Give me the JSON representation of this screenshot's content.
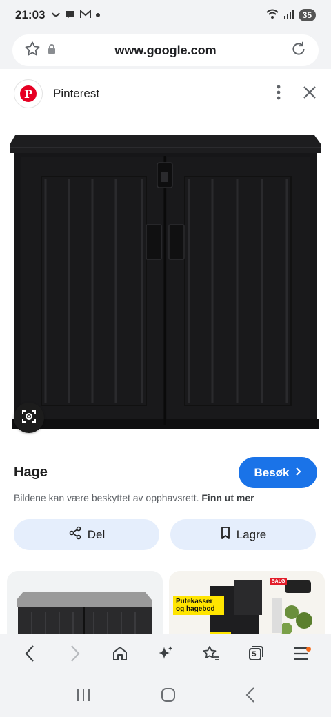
{
  "status_bar": {
    "time": "21:03",
    "battery": "35"
  },
  "address_bar": {
    "url": "www.google.com"
  },
  "source": {
    "name": "Pinterest",
    "logo_letter": "P"
  },
  "result": {
    "title": "Hage",
    "visit_label": "Besøk",
    "copyright_text": "Bildene kan være beskyttet av opphavsrett.",
    "learn_more": "Finn ut mer",
    "share_label": "Del",
    "save_label": "Lagre"
  },
  "related": {
    "promo_text": "Putekasser og hagebod",
    "sale_badge": "SALG"
  },
  "toolbar": {
    "tabs_count": "5"
  },
  "colors": {
    "accent": "#1a73e8",
    "pill_bg": "#e5eefc",
    "pinterest_red": "#e60023",
    "chrome_bg": "#f2f3f5"
  }
}
